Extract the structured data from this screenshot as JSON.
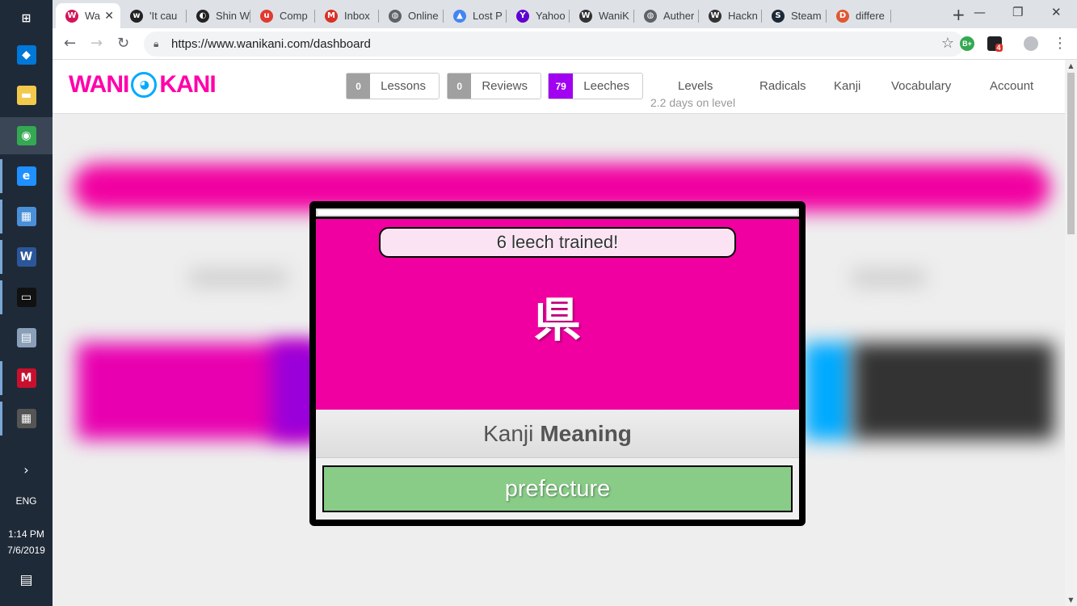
{
  "taskbar": {
    "icons": [
      {
        "name": "windows-start-icon",
        "glyph": "⊞",
        "color": "#1f2a38"
      },
      {
        "name": "store-icon",
        "glyph": "◆",
        "color": "#0078d7"
      },
      {
        "name": "file-explorer-icon",
        "glyph": "▬",
        "color": "#f2c94c"
      },
      {
        "name": "chrome-icon",
        "glyph": "◉",
        "color": "#34a853"
      },
      {
        "name": "edge-icon",
        "glyph": "e",
        "color": "#1e90ff"
      },
      {
        "name": "control-panel-icon",
        "glyph": "▦",
        "color": "#4a90d9"
      },
      {
        "name": "word-icon",
        "glyph": "W",
        "color": "#2b579a"
      },
      {
        "name": "terminal-icon",
        "glyph": "▭",
        "color": "#111111"
      },
      {
        "name": "network-icon",
        "glyph": "▤",
        "color": "#8aa0b8"
      },
      {
        "name": "mcafee-icon",
        "glyph": "M",
        "color": "#c8102e"
      },
      {
        "name": "calculator-icon",
        "glyph": "▦",
        "color": "#555555"
      }
    ],
    "chevron": "›",
    "language": "ENG",
    "time": "1:14 PM",
    "date": "7/6/2019",
    "notification_glyph": "▤"
  },
  "browser": {
    "tabs": [
      {
        "label": "Wa",
        "fav": "W",
        "color": "#d4145a",
        "active": true
      },
      {
        "label": "'It cau",
        "fav": "w",
        "color": "#222222"
      },
      {
        "label": "Shin W",
        "fav": "◐",
        "color": "#222222"
      },
      {
        "label": "Comp",
        "fav": "u",
        "color": "#e03a2f"
      },
      {
        "label": "Inbox",
        "fav": "M",
        "color": "#d93025"
      },
      {
        "label": "Online",
        "fav": "◍",
        "color": "#5f6368"
      },
      {
        "label": "Lost P",
        "fav": "▲",
        "color": "#4285f4"
      },
      {
        "label": "Yahoo",
        "fav": "Y",
        "color": "#5f01d1"
      },
      {
        "label": "WaniK",
        "fav": "W",
        "color": "#333333"
      },
      {
        "label": "Auther",
        "fav": "◍",
        "color": "#5f6368"
      },
      {
        "label": "Hackn",
        "fav": "W",
        "color": "#333333"
      },
      {
        "label": "Steam",
        "fav": "S",
        "color": "#1b2838"
      },
      {
        "label": "differe",
        "fav": "D",
        "color": "#de5833"
      }
    ],
    "new_tab": "+",
    "minimize": "—",
    "restore": "❐",
    "close": "✕",
    "back": "←",
    "forward": "→",
    "reload": "↻",
    "url": "https://www.wanikani.com/dashboard",
    "star": "☆",
    "ext_badge": "4",
    "ext_green": "B+",
    "menu": "⋮"
  },
  "wanikani": {
    "logo_left": "WANI",
    "logo_right": "KANI",
    "lessons": {
      "count": "0",
      "label": "Lessons"
    },
    "reviews": {
      "count": "0",
      "label": "Reviews"
    },
    "leeches": {
      "count": "79",
      "label": "Leeches"
    },
    "nav": {
      "levels": "Levels",
      "levels_sub": "2.2 days on level",
      "radicals": "Radicals",
      "kanji": "Kanji",
      "vocabulary": "Vocabulary",
      "account": "Account"
    },
    "colors": {
      "pink": "#f100a1",
      "lessons_grey": "#a0a0a0",
      "leeches_purple": "#a100f1",
      "answer_green": "#88cc88"
    }
  },
  "modal": {
    "trained_text": "6 leech trained!",
    "character": "県",
    "type_label": "Kanji",
    "question_label": "Meaning",
    "answer": "prefecture"
  }
}
